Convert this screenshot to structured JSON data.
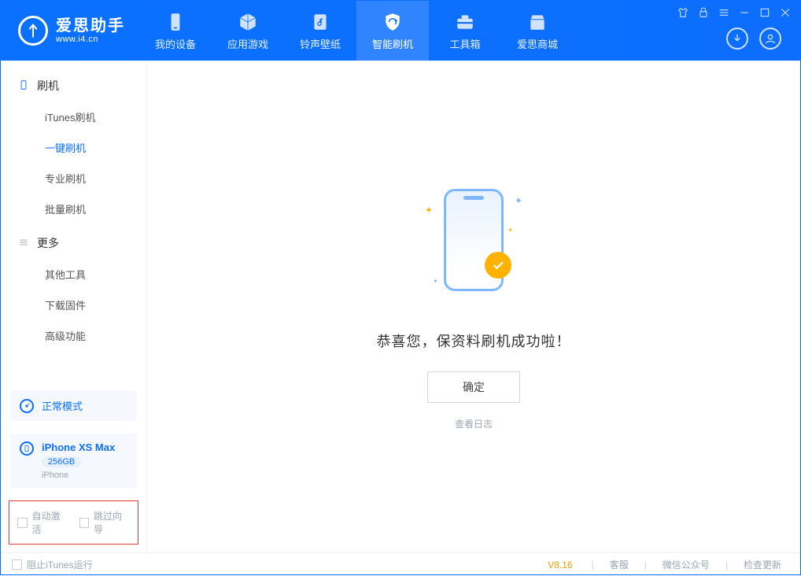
{
  "colors": {
    "primary": "#0d6efd",
    "accent": "#ffb300",
    "danger_border": "#e53935"
  },
  "header": {
    "brand_cn": "爱思助手",
    "brand_url": "www.i4.cn",
    "tabs": [
      {
        "label": "我的设备",
        "icon": "device-icon"
      },
      {
        "label": "应用游戏",
        "icon": "cube-icon"
      },
      {
        "label": "铃声壁纸",
        "icon": "music-file-icon"
      },
      {
        "label": "智能刷机",
        "icon": "refresh-shield-icon"
      },
      {
        "label": "工具箱",
        "icon": "toolbox-icon"
      },
      {
        "label": "爱思商城",
        "icon": "shop-icon"
      }
    ],
    "active_tab_index": 3
  },
  "sidebar": {
    "groups": [
      {
        "title": "刷机",
        "icon": "phone-outline-icon",
        "items": [
          {
            "label": "iTunes刷机"
          },
          {
            "label": "一键刷机",
            "active": true
          },
          {
            "label": "专业刷机"
          },
          {
            "label": "批量刷机"
          }
        ]
      },
      {
        "title": "更多",
        "icon": "menu-icon",
        "items": [
          {
            "label": "其他工具"
          },
          {
            "label": "下载固件"
          },
          {
            "label": "高级功能"
          }
        ]
      }
    ],
    "mode_card": {
      "label": "正常模式"
    },
    "device_card": {
      "name": "iPhone XS Max",
      "storage": "256GB",
      "type": "iPhone"
    },
    "bottom_options": [
      {
        "label": "自动激活",
        "checked": false
      },
      {
        "label": "跳过向导",
        "checked": false
      }
    ]
  },
  "main": {
    "success_message": "恭喜您，保资料刷机成功啦！",
    "ok_button": "确定",
    "view_log": "查看日志"
  },
  "footer": {
    "block_itunes": "阻止iTunes运行",
    "version": "V8.16",
    "links": [
      "客服",
      "微信公众号",
      "检查更新"
    ]
  }
}
